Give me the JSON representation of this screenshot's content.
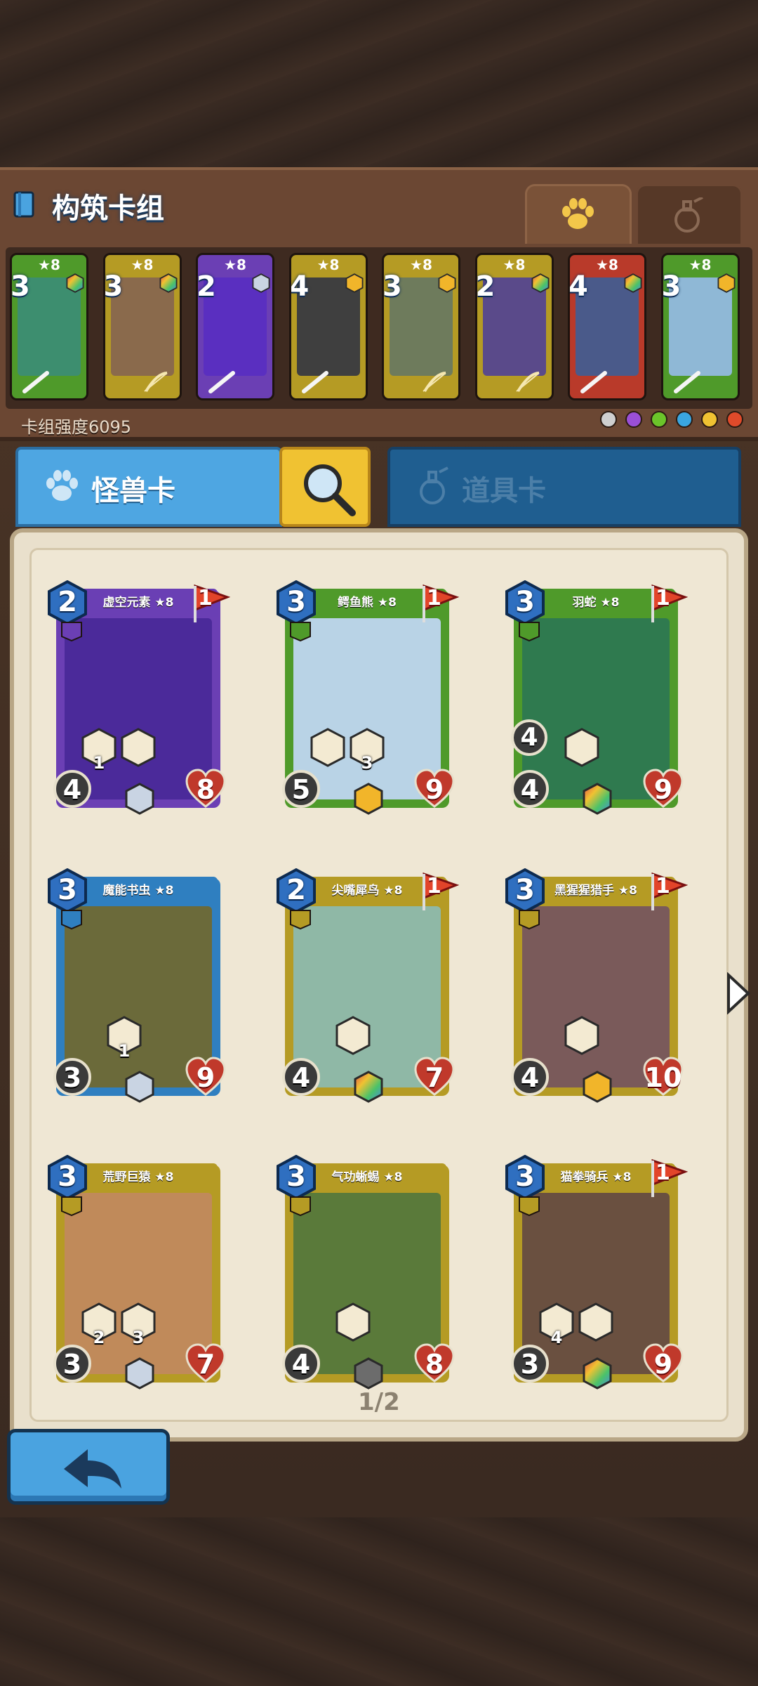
{
  "header": {
    "title": "构筑卡组",
    "deck_power": "卡组强度6095"
  },
  "type_tabs": [
    {
      "name": "monster-type-tab",
      "icon": "paw-icon",
      "active": true
    },
    {
      "name": "item-type-tab",
      "icon": "potion-icon",
      "active": false
    }
  ],
  "deck": [
    {
      "cost": "3",
      "star": "★8",
      "color": "#4f9a2a",
      "art": "#3d8e6f",
      "gem": "rainbow",
      "weapon": "sword-bow"
    },
    {
      "cost": "3",
      "star": "★8",
      "color": "#b59b24",
      "art": "#8a6a4c",
      "gem": "rainbow",
      "weapon": "bow"
    },
    {
      "cost": "2",
      "star": "★8",
      "color": "#6b3fb4",
      "art": "#5a2fc0",
      "gem": "silver",
      "weapon": "sword"
    },
    {
      "cost": "4",
      "star": "★8",
      "color": "#b59b24",
      "art": "#3f3f3f",
      "gem": "gold",
      "weapon": "sword"
    },
    {
      "cost": "3",
      "star": "★8",
      "color": "#b59b24",
      "art": "#6e7b5c",
      "gem": "gold",
      "weapon": "bow"
    },
    {
      "cost": "2",
      "star": "★8",
      "color": "#b59b24",
      "art": "#5a4a8a",
      "gem": "rainbow",
      "weapon": "bow"
    },
    {
      "cost": "4",
      "star": "★8",
      "color": "#b93a2a",
      "art": "#4a5a8a",
      "gem": "rainbow",
      "weapon": "sword"
    },
    {
      "cost": "3",
      "star": "★8",
      "color": "#4f9a2a",
      "art": "#8fb8d6",
      "gem": "gold",
      "weapon": "sword"
    }
  ],
  "faction_icons": [
    {
      "icon": "neutral-icon",
      "color": "#cfcfcf"
    },
    {
      "icon": "void-icon",
      "color": "#9a4fd6"
    },
    {
      "icon": "nature-icon",
      "color": "#6bc42a"
    },
    {
      "icon": "water-icon",
      "color": "#3aa6e0"
    },
    {
      "icon": "storm-icon",
      "color": "#f0c232"
    },
    {
      "icon": "fire-icon",
      "color": "#e04a2a"
    }
  ],
  "tabs": {
    "monster_label": "怪兽卡",
    "item_label": "道具卡"
  },
  "cards": [
    {
      "name": "虚空元素 ★8",
      "cost": "2",
      "flag": "1",
      "atk": "4",
      "hp": "8",
      "range": "",
      "frame": "#6b3fb4",
      "banner": "#6a3fb4",
      "art": "#4b2a9a",
      "gem": "silver",
      "abilities": [
        {
          "value": "1"
        },
        {
          "value": ""
        }
      ]
    },
    {
      "name": "鳄鱼熊 ★8",
      "cost": "3",
      "flag": "1",
      "atk": "5",
      "hp": "9",
      "range": "",
      "frame": "#4f9a2a",
      "banner": "#4f9a2a",
      "art": "#b9d3e6",
      "gem": "gold",
      "abilities": [
        {
          "value": ""
        },
        {
          "value": "3"
        }
      ]
    },
    {
      "name": "羽蛇 ★8",
      "cost": "3",
      "flag": "1",
      "atk": "4",
      "hp": "9",
      "range": "4",
      "frame": "#4f9a2a",
      "banner": "#4f9a2a",
      "art": "#2f7a4f",
      "gem": "rainbow",
      "abilities": [
        {
          "value": ""
        }
      ]
    },
    {
      "name": "魔能书虫 ★8",
      "cost": "3",
      "flag": "",
      "atk": "3",
      "hp": "9",
      "range": "",
      "frame": "#2f7fc0",
      "banner": "#2f7fc0",
      "art": "#6b6a3a",
      "gem": "silver",
      "abilities": [
        {
          "value": "1"
        }
      ]
    },
    {
      "name": "尖嘴犀鸟 ★8",
      "cost": "2",
      "flag": "1",
      "atk": "4",
      "hp": "7",
      "range": "",
      "frame": "#b59b24",
      "banner": "#b59b24",
      "art": "#8fb8a6",
      "gem": "rainbow",
      "abilities": [
        {
          "value": ""
        }
      ]
    },
    {
      "name": "黑猩猩猎手 ★8",
      "cost": "3",
      "flag": "1",
      "atk": "4",
      "hp": "10",
      "range": "",
      "frame": "#b59b24",
      "banner": "#b59b24",
      "art": "#7a5a5a",
      "gem": "gold",
      "abilities": [
        {
          "value": ""
        }
      ]
    },
    {
      "name": "荒野巨猿 ★8",
      "cost": "3",
      "flag": "",
      "atk": "3",
      "hp": "7",
      "range": "",
      "frame": "#b59b24",
      "banner": "#b59b24",
      "art": "#c08a5a",
      "gem": "silver",
      "abilities": [
        {
          "value": "2"
        },
        {
          "value": "3"
        }
      ]
    },
    {
      "name": "气功蜥蜴 ★8",
      "cost": "3",
      "flag": "",
      "atk": "4",
      "hp": "8",
      "range": "",
      "frame": "#b59b24",
      "banner": "#b59b24",
      "art": "#5a7a3a",
      "gem": "dark",
      "abilities": [
        {
          "value": ""
        }
      ]
    },
    {
      "name": "猫拳骑兵 ★8",
      "cost": "3",
      "flag": "1",
      "atk": "3",
      "hp": "9",
      "range": "",
      "frame": "#b59b24",
      "banner": "#b59b24",
      "art": "#6a5040",
      "gem": "rainbow",
      "abilities": [
        {
          "value": "4"
        },
        {
          "value": ""
        }
      ]
    }
  ],
  "pager": "1/2"
}
